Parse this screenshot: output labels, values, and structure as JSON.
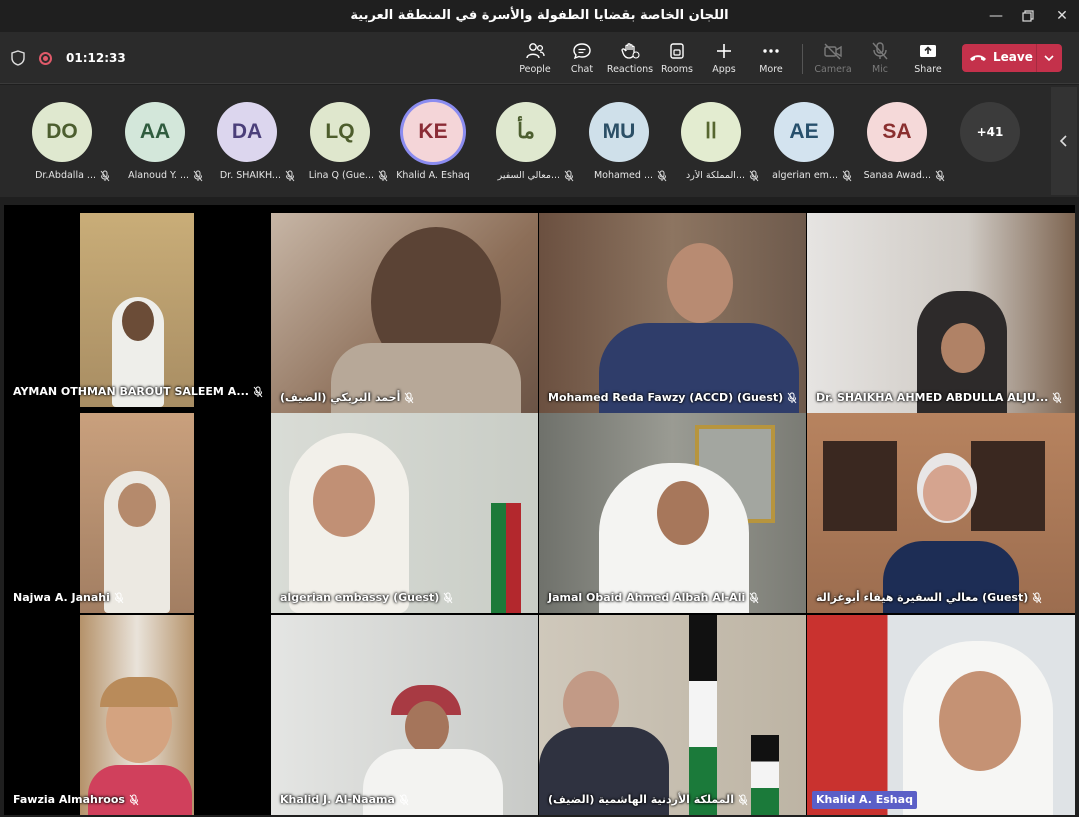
{
  "window": {
    "title": "اللجان الخاصة بقضايا الطفولة والأسرة في المنطقة العربية"
  },
  "toolbar": {
    "timer": "01:12:33",
    "buttons": [
      {
        "label": "People",
        "icon": "people-icon"
      },
      {
        "label": "Chat",
        "icon": "chat-icon"
      },
      {
        "label": "Reactions",
        "icon": "reactions-icon"
      },
      {
        "label": "Rooms",
        "icon": "rooms-icon"
      },
      {
        "label": "Apps",
        "icon": "apps-icon"
      },
      {
        "label": "More",
        "icon": "more-icon"
      },
      {
        "label": "Camera",
        "icon": "camera-off-icon",
        "disabled": true
      },
      {
        "label": "Mic",
        "icon": "mic-off-icon",
        "disabled": true
      },
      {
        "label": "Share",
        "icon": "share-icon"
      }
    ],
    "leave_label": "Leave",
    "leave_color": "#c4314b"
  },
  "participants": [
    {
      "initials": "DO",
      "name": "Dr.Abdalla ...",
      "bg": "#dfe8cf",
      "fg": "#4c5e2f"
    },
    {
      "initials": "AA",
      "name": "Alanoud Y. ...",
      "bg": "#d3e7da",
      "fg": "#2f5c3e"
    },
    {
      "initials": "DA",
      "name": "Dr. SHAIKH...",
      "bg": "#dcd6ee",
      "fg": "#4b3f7a"
    },
    {
      "initials": "LQ",
      "name": "Lina Q (Gue...",
      "bg": "#dfe7cd",
      "fg": "#4d5d2c"
    },
    {
      "initials": "KE",
      "name": "Khalid A. Eshaq",
      "bg": "#f4d5d8",
      "fg": "#8a2b35",
      "active": true
    },
    {
      "initials": "مأ",
      "name": "معالي السفير...",
      "bg": "#dfe8cf",
      "fg": "#4c5e2f"
    },
    {
      "initials": "MU",
      "name": "Mohamed ...",
      "bg": "#cfe0ea",
      "fg": "#2b4f66"
    },
    {
      "initials": "اا",
      "name": "المملكة الأرد...",
      "bg": "#e3ecd0",
      "fg": "#56662f"
    },
    {
      "initials": "AE",
      "name": "algerian em...",
      "bg": "#d3e3ef",
      "fg": "#27506c"
    },
    {
      "initials": "SA",
      "name": "Sanaa Awad...",
      "bg": "#f5d9d9",
      "fg": "#8a2f2f"
    }
  ],
  "overflow_count": "+41",
  "videos": [
    {
      "name": "AYMAN OTHMAN BAROUT SALEEM A...",
      "bg": "#b79c6c"
    },
    {
      "name": "(أحمد البريكي (الضيف",
      "bg": "#8f7561"
    },
    {
      "name": "Mohamed Reda Fawzy (ACCD) (Guest)",
      "bg": "#7b6a5c"
    },
    {
      "name": "Dr. SHAIKHA AHMED ABDULLA ALJU...",
      "bg": "#c8c2bc"
    },
    {
      "name": "Najwa A. Janahi",
      "bg": "#b49474"
    },
    {
      "name": "algerian embassy (Guest)",
      "bg": "#cdd2cc"
    },
    {
      "name": "Jamal Obaid Ahmed Albah Al-Ali",
      "bg": "#8a8b85"
    },
    {
      "name": "معالي السفيرة هيفاء أبوغزالة (Guest)",
      "bg": "#b4866a"
    },
    {
      "name": "Fawzia Almahroos",
      "bg": "#c5a78a"
    },
    {
      "name": "Khalid J. Al-Naama",
      "bg": "#d2d5d2"
    },
    {
      "name": "(المملكة الأردنية الهاشمية (الضيف",
      "bg": "#c8c0b0"
    },
    {
      "name": "Khalid A. Eshaq",
      "bg": "#d8dde0",
      "speaking": true
    }
  ]
}
